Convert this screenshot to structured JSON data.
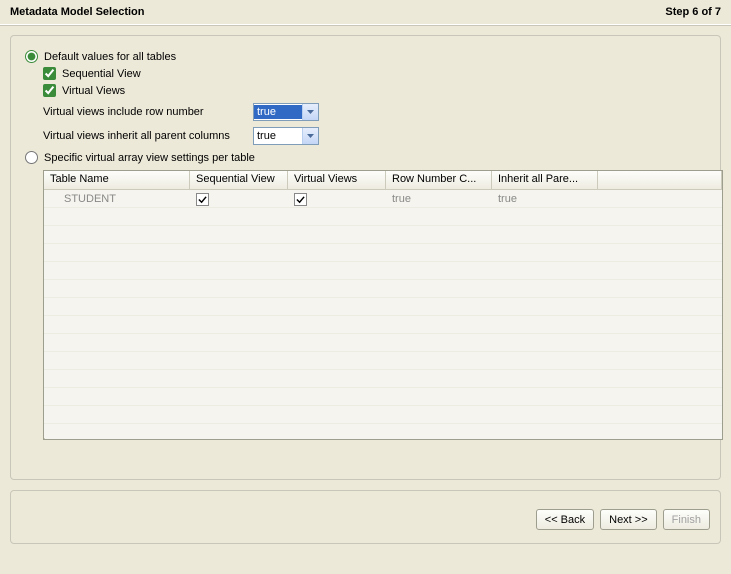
{
  "header": {
    "title": "Metadata Model Selection",
    "step": "Step 6 of 7"
  },
  "options": {
    "default_all_label": "Default values for all tables",
    "default_all_selected": true,
    "sequential_view_label": "Sequential View",
    "sequential_view_checked": true,
    "virtual_views_label": "Virtual Views",
    "virtual_views_checked": true,
    "row_number_label": "Virtual views include row number",
    "row_number_value": "true",
    "inherit_parent_label": "Virtual views inherit all parent columns",
    "inherit_parent_value": "true",
    "specific_label": "Specific virtual array view settings per table",
    "specific_selected": false
  },
  "grid": {
    "columns": {
      "name": "Table Name",
      "seq": "Sequential View",
      "vv": "Virtual Views",
      "row": "Row Number C...",
      "inh": "Inherit all Pare..."
    },
    "rows": [
      {
        "name": "STUDENT",
        "seq_checked": true,
        "vv_checked": true,
        "row_number": "true",
        "inherit": "true"
      }
    ]
  },
  "buttons": {
    "back": "<< Back",
    "next": "Next >>",
    "finish": "Finish"
  }
}
